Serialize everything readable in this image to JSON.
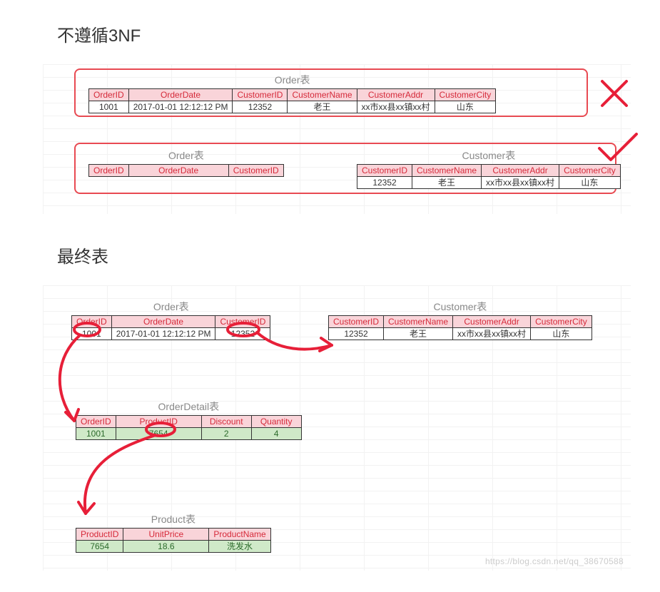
{
  "section1": {
    "title": "不遵循3NF"
  },
  "section2": {
    "title": "最终表"
  },
  "t1": {
    "caption": "Order表",
    "headers": [
      "OrderID",
      "OrderDate",
      "CustomerID",
      "CustomerName",
      "CustomerAddr",
      "CustomerCity"
    ],
    "row": [
      "1001",
      "2017-01-01  12:12:12 PM",
      "12352",
      "老王",
      "xx市xx县xx镇xx村",
      "山东"
    ]
  },
  "t2a": {
    "caption": "Order表",
    "headers": [
      "OrderID",
      "OrderDate",
      "CustomerID"
    ]
  },
  "t2b": {
    "caption": "Customer表",
    "headers": [
      "CustomerID",
      "CustomerName",
      "CustomerAddr",
      "CustomerCity"
    ],
    "row": [
      "12352",
      "老王",
      "xx市xx县xx镇xx村",
      "山东"
    ]
  },
  "f_order": {
    "caption": "Order表",
    "headers": [
      "OrderID",
      "OrderDate",
      "CustomerID"
    ],
    "row": [
      "1001",
      "2017-01-01  12:12:12 PM",
      "12352"
    ]
  },
  "f_customer": {
    "caption": "Customer表",
    "headers": [
      "CustomerID",
      "CustomerName",
      "CustomerAddr",
      "CustomerCity"
    ],
    "row": [
      "12352",
      "老王",
      "xx市xx县xx镇xx村",
      "山东"
    ]
  },
  "f_orderdetail": {
    "caption": "OrderDetail表",
    "headers": [
      "OrderID",
      "ProductID",
      "Discount",
      "Quantity"
    ],
    "row": [
      "1001",
      "7654",
      "2",
      "4"
    ]
  },
  "f_product": {
    "caption": "Product表",
    "headers": [
      "ProductID",
      "UnitPrice",
      "ProductName"
    ],
    "row": [
      "7654",
      "18.6",
      "洗发水"
    ]
  },
  "watermark": "https://blog.csdn.net/qq_38670588"
}
